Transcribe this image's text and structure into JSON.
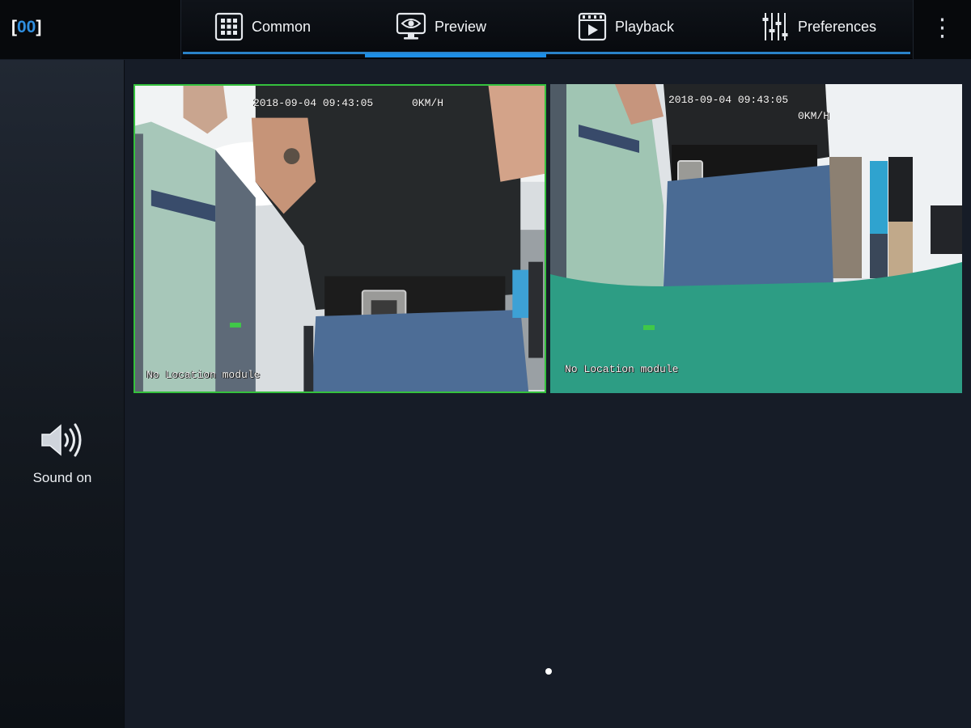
{
  "brand": {
    "open": "[",
    "text": "00",
    "close": "]"
  },
  "tabs": [
    {
      "label": "Common",
      "icon": "grid-icon"
    },
    {
      "label": "Preview",
      "icon": "monitor-eye-icon"
    },
    {
      "label": "Playback",
      "icon": "video-play-icon"
    },
    {
      "label": "Preferences",
      "icon": "sliders-icon"
    }
  ],
  "active_tab": "Preview",
  "menu": {
    "more_glyph": "⋮"
  },
  "side": {
    "sound_label": "Sound on",
    "sound_icon": "speaker-icon"
  },
  "videos": [
    {
      "timestamp": "2018-09-04 09:43:05",
      "speed": "0KM/H",
      "location": "No Location module",
      "selected": true
    },
    {
      "timestamp": "2018-09-04 09:43:05",
      "speed": "0KM/H",
      "location": "No Location module",
      "selected": false
    }
  ],
  "colors": {
    "accent": "#1e8ee6",
    "brand": "#2f8fe0",
    "selected_border": "#35c13d",
    "background": "#161c27"
  },
  "pagination": {
    "pages": 1,
    "current": 1
  }
}
